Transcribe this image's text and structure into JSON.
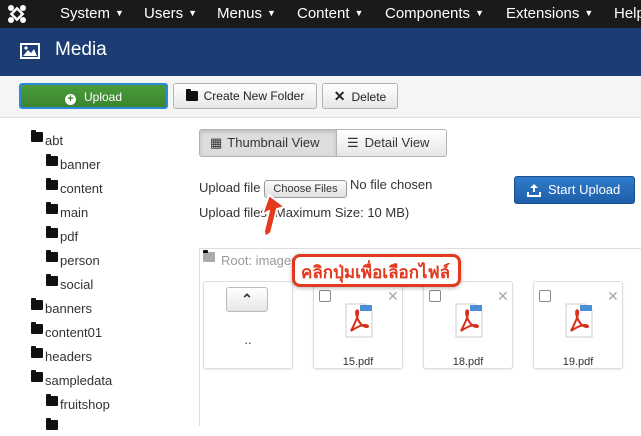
{
  "topbar": {
    "menus": [
      {
        "label": "System"
      },
      {
        "label": "Users"
      },
      {
        "label": "Menus"
      },
      {
        "label": "Content"
      },
      {
        "label": "Components"
      },
      {
        "label": "Extensions"
      },
      {
        "label": "Help"
      }
    ]
  },
  "header": {
    "title": "Media"
  },
  "toolbar": {
    "upload": "Upload",
    "new_folder": "Create New Folder",
    "delete": "Delete"
  },
  "tree": [
    "abt",
    "banner",
    "content",
    "main",
    "pdf",
    "person",
    "social",
    "banners",
    "content01",
    "headers",
    "sampledata",
    "fruitshop"
  ],
  "view": {
    "thumbnail": "Thumbnail View",
    "detail": "Detail View"
  },
  "upload": {
    "label": "Upload file",
    "choose": "Choose Files",
    "status": "No file chosen",
    "info": "Upload files (Maximum Size: 10 MB)",
    "start": "Start Upload"
  },
  "browser": {
    "root": "Root: images",
    "up": "..",
    "files": [
      "15.pdf",
      "18.pdf",
      "19.pdf"
    ]
  },
  "annotation": {
    "text": "คลิกปุ่มเพื่อเลือกไฟล์",
    "color": "#e2391f"
  },
  "colors": {
    "topbar": "#1a1a1a",
    "header": "#1b3d74",
    "upload_btn": "#3c8430",
    "start_btn": "#1f5ea8"
  }
}
